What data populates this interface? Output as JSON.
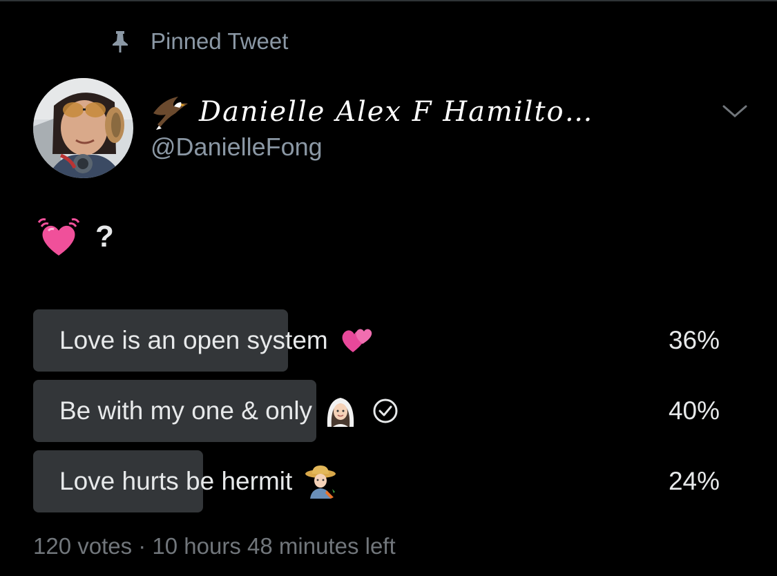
{
  "pinned_label": "Pinned Tweet",
  "author": {
    "display_name": "Danielle Alex F Hamilto…",
    "handle": "@DanielleFong"
  },
  "tweet": {
    "text": "?",
    "emoji": "heart-with-vibration-icon"
  },
  "poll": {
    "options": [
      {
        "label": "Love is an open system",
        "percent": "36%",
        "value": 0.36,
        "emoji": "two-hearts-icon"
      },
      {
        "label": "Be with my one & only",
        "percent": "40%",
        "value": 0.4,
        "emoji": "bride-with-veil-icon",
        "selected": true
      },
      {
        "label": "Love hurts be hermit",
        "percent": "24%",
        "value": 0.24,
        "emoji": "farmer-icon"
      }
    ],
    "meta": "120 votes · 10 hours 48 minutes left"
  },
  "colors": {
    "background": "#000000",
    "bar": "#333639",
    "text": "#e7e9ea",
    "secondary": "#8b98a5"
  }
}
